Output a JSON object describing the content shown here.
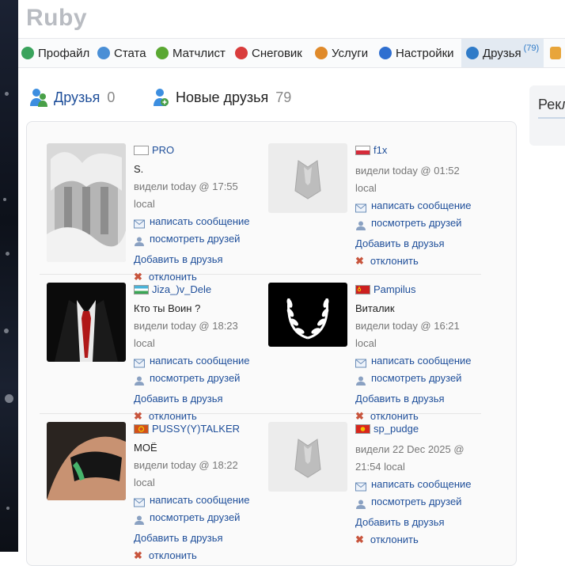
{
  "app": {
    "title": "Ruby"
  },
  "nav": [
    {
      "label": "Профайл",
      "icon": "profile-icon"
    },
    {
      "label": "Стата",
      "icon": "stats-icon"
    },
    {
      "label": "Матчлист",
      "icon": "matchlist-icon"
    },
    {
      "label": "Снеговик",
      "icon": "snowman-icon"
    },
    {
      "label": "Услуги",
      "icon": "services-icon"
    },
    {
      "label": "Настройки",
      "icon": "settings-icon"
    },
    {
      "label": "Друзья",
      "icon": "friends-icon",
      "badge": "(79)",
      "active": true
    }
  ],
  "tabs": [
    {
      "label": "Друзья",
      "count": "0",
      "icon": "friends-icon"
    },
    {
      "label": "Новые друзья",
      "count": "79",
      "icon": "new-friends-icon"
    }
  ],
  "side": {
    "title": "Рекл"
  },
  "actions": {
    "message": "написать сообщение",
    "friends": "посмотреть друзей",
    "add": "Добавить в друзья",
    "reject": "отклонить"
  },
  "requests": [
    {
      "name": "PRO",
      "flag": "plain",
      "status": "S.",
      "seen": "видели today @ 17:55 local",
      "avatar": "winter-palace"
    },
    {
      "name": "f1x",
      "flag": "pl",
      "status": "",
      "seen": "видели today @ 01:52 local",
      "avatar": "default"
    },
    {
      "name": "Jiza_)v_Dele",
      "flag": "uz",
      "status": "Кто ты Воин ?",
      "seen": "видели today @ 18:23 local",
      "avatar": "suit"
    },
    {
      "name": "Pampilus",
      "flag": "ussr",
      "status": "Виталик",
      "seen": "видели today @ 16:21 local",
      "avatar": "laurel"
    },
    {
      "name": "PUSSY(Y)TALKER",
      "flag": "pirate",
      "status": "МОЁ",
      "seen": "видели today @ 18:22 local",
      "avatar": "photo"
    },
    {
      "name": "sp_pudge",
      "flag": "kg",
      "status": "",
      "seen": "видели 22 Dec 2025 @ 21:54 local",
      "avatar": "default"
    }
  ]
}
